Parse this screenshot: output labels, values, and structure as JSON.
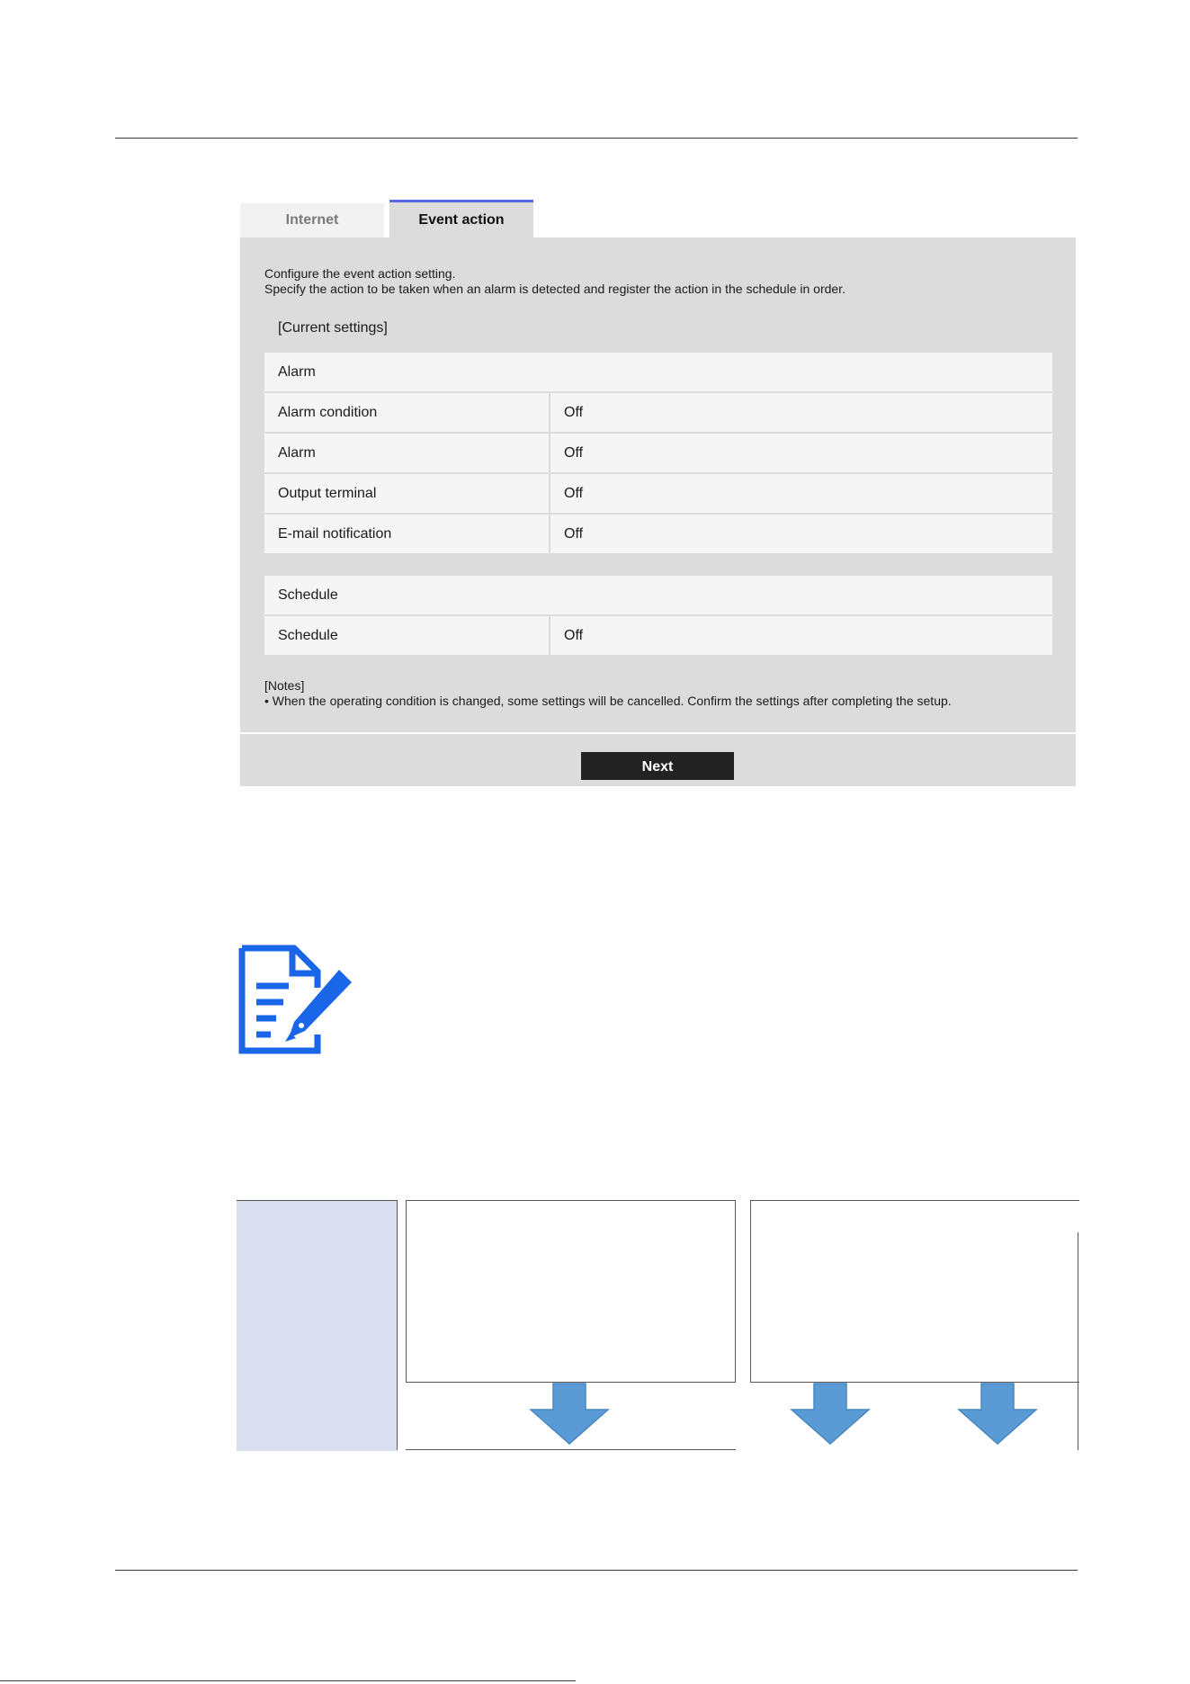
{
  "tabs": [
    {
      "label": "Internet",
      "active": false
    },
    {
      "label": "Event action",
      "active": true
    }
  ],
  "intro": {
    "line1": "Configure the event action setting.",
    "line2": "Specify the action to be taken when an alarm is detected and register the action in the schedule in order."
  },
  "current_settings_label": "[Current settings]",
  "alarm_table": {
    "header": "Alarm",
    "rows": [
      {
        "label": "Alarm condition",
        "value": "Off"
      },
      {
        "label": "Alarm",
        "value": "Off"
      },
      {
        "label": "Output terminal",
        "value": "Off"
      },
      {
        "label": "E-mail notification",
        "value": "Off"
      }
    ]
  },
  "schedule_table": {
    "header": "Schedule",
    "rows": [
      {
        "label": "Schedule",
        "value": "Off"
      }
    ]
  },
  "notes": {
    "title": "[Notes]",
    "line1": "• When the operating condition is changed, some settings will be cancelled. Confirm the settings after completing the setup."
  },
  "next_button": "Next",
  "icons": {
    "note": "document-pen-icon",
    "arrow": "arrow-down-icon"
  },
  "colors": {
    "accent_tab": "#5a68e6",
    "icon_blue": "#1a66e8",
    "arrow_blue": "#5b9bd5",
    "flow_side": "#dadff0"
  }
}
